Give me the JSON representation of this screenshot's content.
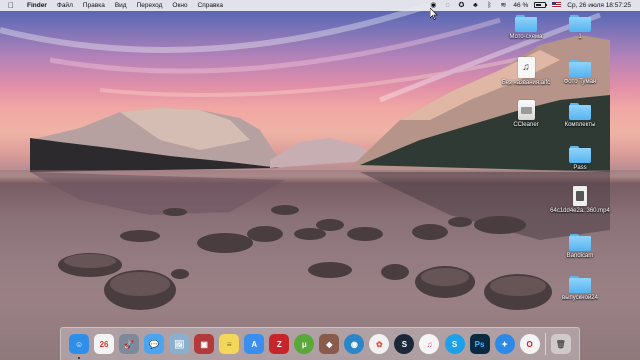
{
  "menubar": {
    "apple_icon": "apple-icon",
    "items": [
      {
        "label": "Finder",
        "bold": true
      },
      {
        "label": "Файл"
      },
      {
        "label": "Правка"
      },
      {
        "label": "Вид"
      },
      {
        "label": "Переход"
      },
      {
        "label": "Окно"
      },
      {
        "label": "Справка"
      }
    ],
    "status": {
      "battery_percent_label": "46 %",
      "battery_level": 0.46,
      "datetime": "Ср, 26 июля  18:57:25"
    }
  },
  "desktop": {
    "icons": [
      {
        "name": "desktop-folder-moto-skhema",
        "kind": "folder",
        "label": "Мото-схема"
      },
      {
        "name": "desktop-folder-1",
        "kind": "folder",
        "label": "1"
      },
      {
        "name": "desktop-file-bez-nazvaniya",
        "kind": "aifc",
        "label": "Без названия.aifc"
      },
      {
        "name": "desktop-folder-foto-tuman",
        "kind": "folder",
        "label": "Фото Туман"
      },
      {
        "name": "desktop-app-ccleaner",
        "kind": "ccleaner",
        "label": "CCleaner"
      },
      {
        "name": "desktop-folder-komplekty",
        "kind": "folder",
        "label": "Комплекты"
      },
      {
        "name": "desktop-folder-pass",
        "kind": "folder",
        "label": "Pass"
      },
      {
        "name": "desktop-file-video",
        "kind": "video",
        "label": "64c1dd4e2a. 360.mp4"
      },
      {
        "name": "desktop-folder-bandicam",
        "kind": "folder",
        "label": "Bandicam"
      },
      {
        "name": "desktop-folder-vypusknoy24",
        "kind": "folder",
        "label": "выпускной24"
      }
    ]
  },
  "dock": {
    "apps": [
      {
        "name": "finder-icon",
        "glyph": "☺",
        "color": "#2f8fe8",
        "running": true
      },
      {
        "name": "calendar-icon",
        "glyph": "26",
        "color": "#f4f4f4",
        "text_color": "#d33"
      },
      {
        "name": "launchpad-icon",
        "glyph": "🚀",
        "color": "#7d8a9c"
      },
      {
        "name": "messages-icon",
        "glyph": "💬",
        "color": "#4aa4ef"
      },
      {
        "name": "preview-icon",
        "glyph": "🖼",
        "color": "#8bb0cf"
      },
      {
        "name": "photo-booth-icon",
        "glyph": "▣",
        "color": "#b33a3a"
      },
      {
        "name": "notes-icon",
        "glyph": "≡",
        "color": "#f3d65a",
        "text_color": "#7a6a20"
      },
      {
        "name": "app-store-icon",
        "glyph": "A",
        "color": "#3a8ef0"
      },
      {
        "name": "filezilla-icon",
        "glyph": "Z",
        "color": "#c8242b"
      },
      {
        "name": "utorrent-icon",
        "glyph": "μ",
        "color": "#5aa83a",
        "round": true
      },
      {
        "name": "crossover-icon",
        "glyph": "◆",
        "color": "#8a5a4a"
      },
      {
        "name": "cleanmymac-icon",
        "glyph": "◉",
        "color": "#2b86c7",
        "round": true
      },
      {
        "name": "photos-icon",
        "glyph": "✿",
        "color": "#f2f2f2",
        "text_color": "#e0513b",
        "round": true
      },
      {
        "name": "steam-icon",
        "glyph": "S",
        "color": "#1b2838",
        "round": true
      },
      {
        "name": "itunes-icon",
        "glyph": "♫",
        "color": "#f5f5f5",
        "text_color": "#e0448a",
        "round": true
      },
      {
        "name": "skype-icon",
        "glyph": "S",
        "color": "#1ea0e8",
        "round": true
      },
      {
        "name": "photoshop-icon",
        "glyph": "Ps",
        "color": "#0a2a44",
        "text_color": "#4cb7ff"
      },
      {
        "name": "safari-icon",
        "glyph": "✦",
        "color": "#2c8ae6",
        "round": true
      },
      {
        "name": "opera-icon",
        "glyph": "O",
        "color": "#f5f5f5",
        "text_color": "#d81b1b",
        "round": true
      }
    ],
    "trash": {
      "name": "trash-icon",
      "glyph": "🗑"
    }
  }
}
